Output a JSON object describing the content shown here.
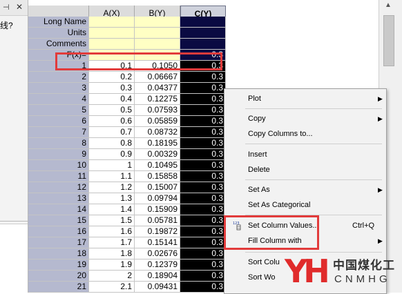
{
  "left_pane": {
    "pin_icon": "pin-icon",
    "close_icon": "close-icon",
    "text": "线?"
  },
  "sheet": {
    "columns": [
      "A(X)",
      "B(Y)",
      "C(Y)"
    ],
    "selected_column": "C(Y)",
    "meta_rows": [
      {
        "label": "Long Name",
        "values": [
          "",
          "",
          ""
        ]
      },
      {
        "label": "Units",
        "values": [
          "",
          "",
          ""
        ]
      },
      {
        "label": "Comments",
        "values": [
          "",
          "",
          ""
        ]
      },
      {
        "label": "F(x)=",
        "values": [
          "",
          "",
          "0.3"
        ]
      }
    ],
    "rows": [
      {
        "n": "1",
        "a": "0.1",
        "b": "0.1050",
        "c": "0.3"
      },
      {
        "n": "2",
        "a": "0.2",
        "b": "0.06667",
        "c": "0.3"
      },
      {
        "n": "3",
        "a": "0.3",
        "b": "0.04377",
        "c": "0.3"
      },
      {
        "n": "4",
        "a": "0.4",
        "b": "0.12275",
        "c": "0.3"
      },
      {
        "n": "5",
        "a": "0.5",
        "b": "0.07593",
        "c": "0.3"
      },
      {
        "n": "6",
        "a": "0.6",
        "b": "0.05859",
        "c": "0.3"
      },
      {
        "n": "7",
        "a": "0.7",
        "b": "0.08732",
        "c": "0.3"
      },
      {
        "n": "8",
        "a": "0.8",
        "b": "0.18195",
        "c": "0.3"
      },
      {
        "n": "9",
        "a": "0.9",
        "b": "0.00329",
        "c": "0.3"
      },
      {
        "n": "10",
        "a": "1",
        "b": "0.10495",
        "c": "0.3"
      },
      {
        "n": "11",
        "a": "1.1",
        "b": "0.15858",
        "c": "0.3"
      },
      {
        "n": "12",
        "a": "1.2",
        "b": "0.15007",
        "c": "0.3"
      },
      {
        "n": "13",
        "a": "1.3",
        "b": "0.09794",
        "c": "0.3"
      },
      {
        "n": "14",
        "a": "1.4",
        "b": "0.15909",
        "c": "0.3"
      },
      {
        "n": "15",
        "a": "1.5",
        "b": "0.05781",
        "c": "0.3"
      },
      {
        "n": "16",
        "a": "1.6",
        "b": "0.19872",
        "c": "0.3"
      },
      {
        "n": "17",
        "a": "1.7",
        "b": "0.15141",
        "c": "0.3"
      },
      {
        "n": "18",
        "a": "1.8",
        "b": "0.02676",
        "c": "0.3"
      },
      {
        "n": "19",
        "a": "1.9",
        "b": "0.12379",
        "c": "0.3"
      },
      {
        "n": "20",
        "a": "2",
        "b": "0.18904",
        "c": "0.3"
      },
      {
        "n": "21",
        "a": "2.1",
        "b": "0.09431",
        "c": "0.3"
      }
    ]
  },
  "context_menu": {
    "items": [
      {
        "label": "Plot",
        "submenu": true
      },
      {
        "label": "Copy",
        "submenu": true
      },
      {
        "label": "Copy Columns to...",
        "submenu": false
      },
      {
        "label": "Insert",
        "submenu": false
      },
      {
        "label": "Delete",
        "submenu": false
      },
      {
        "label": "Set As",
        "submenu": true
      },
      {
        "label": "Set As Categorical",
        "submenu": false
      },
      {
        "label": "Set Column Values...",
        "shortcut": "Ctrl+Q",
        "submenu": false,
        "icon": "set-values-icon"
      },
      {
        "label": "Fill Column with",
        "submenu": true
      },
      {
        "label": "Sort Colu",
        "submenu": false
      },
      {
        "label": "Sort Wo",
        "submenu": false
      }
    ]
  },
  "watermark": {
    "logo_mark": "YH",
    "cn_text": "中国煤化工",
    "en_text": "CNMHG"
  },
  "colors": {
    "row_header": "#b5b9cf",
    "yellow_meta": "#ffffc4",
    "selected_column_bg": "#0a0a42",
    "highlight_red": "#e23b3b"
  }
}
